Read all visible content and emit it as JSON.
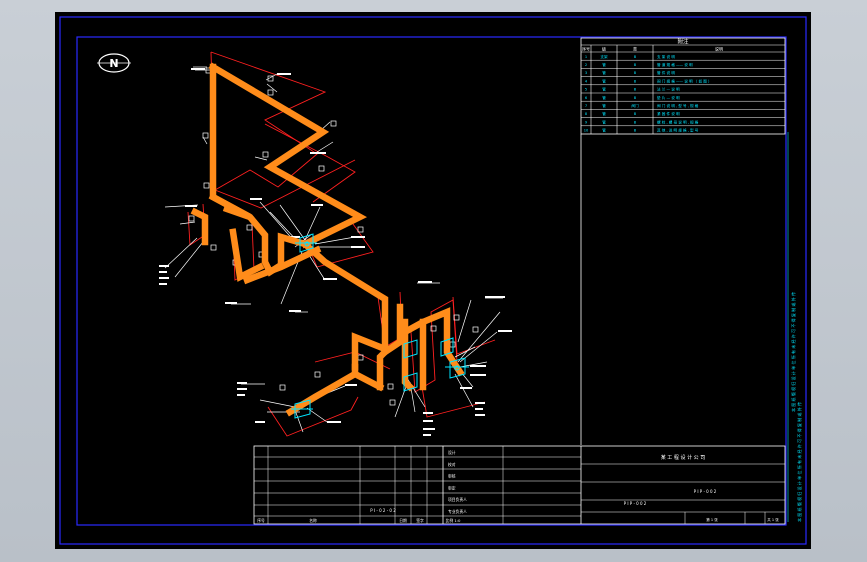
{
  "legend": {
    "title": "附注",
    "headers": [
      "序号",
      "级",
      "类",
      "说明"
    ],
    "rows": [
      {
        "n": "1",
        "a": "支架",
        "b": "B",
        "c": "支 架 说 明"
      },
      {
        "n": "2",
        "a": "管",
        "b": "B",
        "c": "管 道 规 格 —— 说 明"
      },
      {
        "n": "3",
        "a": "管",
        "b": "B",
        "c": "管 件 说 明"
      },
      {
        "n": "4",
        "a": "管",
        "b": "B",
        "c": "阀 门 规 格 —— 说 明 （ 如 图 ）"
      },
      {
        "n": "5",
        "a": "管",
        "b": "B",
        "c": "法 兰 — 说 明"
      },
      {
        "n": "6",
        "a": "管",
        "b": "B",
        "c": "垫 片 — 说 明"
      },
      {
        "n": "7",
        "a": "管",
        "b": "阀门",
        "c": "阀 门 说 明 , 型 号 , 规 格"
      },
      {
        "n": "8",
        "a": "管",
        "b": "B",
        "c": "紧 固 件 说 明"
      },
      {
        "n": "9",
        "a": "管",
        "b": "B",
        "c": "螺 栓 , 螺 母 说 明 , 规 格"
      },
      {
        "n": "10",
        "a": "管",
        "b": "B",
        "c": "其 他 , 说 明 规 格 , 型 号"
      }
    ]
  },
  "north_symbol": "N",
  "title_block": {
    "company": "某 工 程 设 计 公 司",
    "drawing_no": "P I P - 0 0 2",
    "drawing_no_left": "P I P - 0 0 2",
    "left_code": "P I - 0 2 - 0 2",
    "roles": [
      "设计",
      "校对",
      "审核",
      "审定",
      "项目负责人",
      "专业负责人"
    ],
    "bottom": [
      "序号",
      "名称",
      "日期",
      "签字",
      "比例 1:0"
    ],
    "right_code": "第 1 张",
    "sheet_total": "共 1 张"
  },
  "side_note": "本 图 纸 版 权 归 设 计 单 位 所 有 未 经 许 可 不 得 复 制 或 外 传"
}
